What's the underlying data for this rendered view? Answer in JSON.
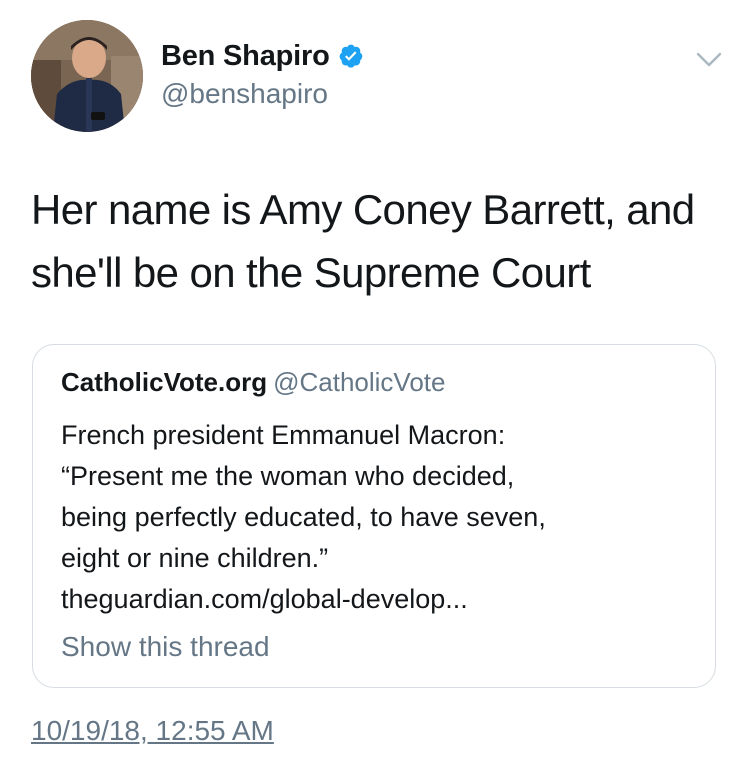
{
  "author": {
    "display_name": "Ben Shapiro",
    "handle": "@benshapiro",
    "verified": true,
    "verified_color": "#1da1f2"
  },
  "tweet": {
    "lines": [
      "Her name is Amy Coney Barrett, and",
      "she'll be on the Supreme Court"
    ],
    "timestamp": "10/19/18, 12:55 AM"
  },
  "quote": {
    "display_name": "CatholicVote.org",
    "handle": "@CatholicVote",
    "lines": [
      "French president Emmanuel Macron:",
      "“Present me the woman who decided,",
      "being perfectly educated, to have seven,",
      "eight or nine children.”",
      "theguardian.com/global-develop..."
    ],
    "show_thread_label": "Show this thread"
  },
  "icons": {
    "verified": "verified-badge-icon",
    "menu": "chevron-down-icon"
  },
  "colors": {
    "text_primary": "#14171a",
    "text_secondary": "#657786",
    "card_border": "#d7dde2"
  }
}
